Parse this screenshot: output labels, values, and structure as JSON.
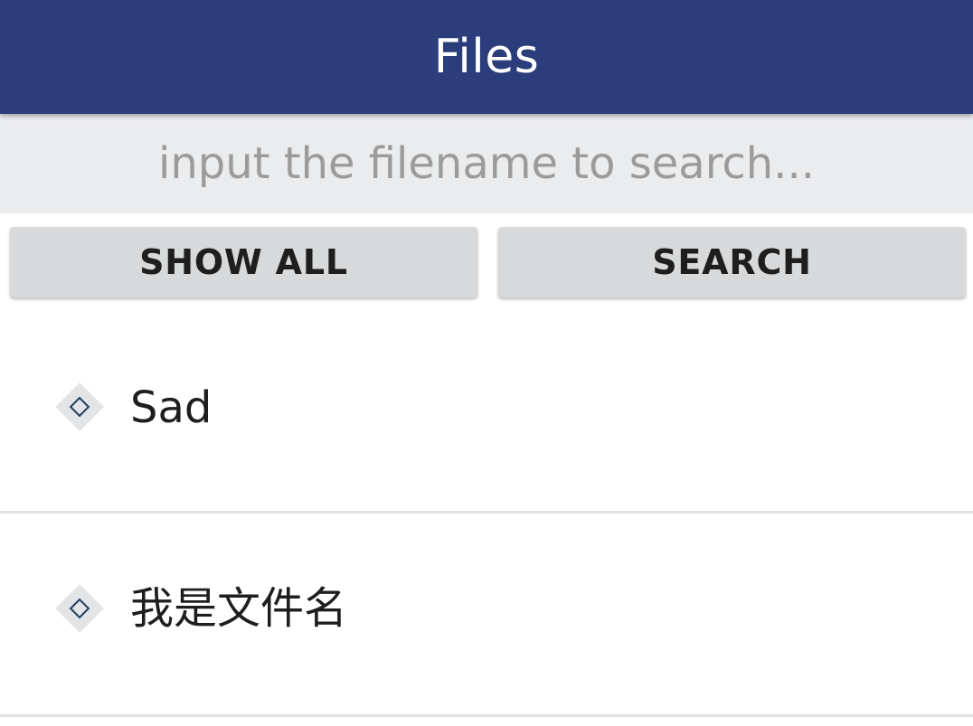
{
  "app_bar": {
    "title": "Files",
    "background_color": "#2b3d7a"
  },
  "search": {
    "placeholder": "input the filename to search...",
    "value": ""
  },
  "buttons": {
    "show_all_label": "SHOW ALL",
    "search_label": "SEARCH"
  },
  "files": [
    {
      "name": "Sad",
      "icon": "diamond-file-icon"
    },
    {
      "name": "我是文件名",
      "icon": "diamond-file-icon"
    }
  ]
}
